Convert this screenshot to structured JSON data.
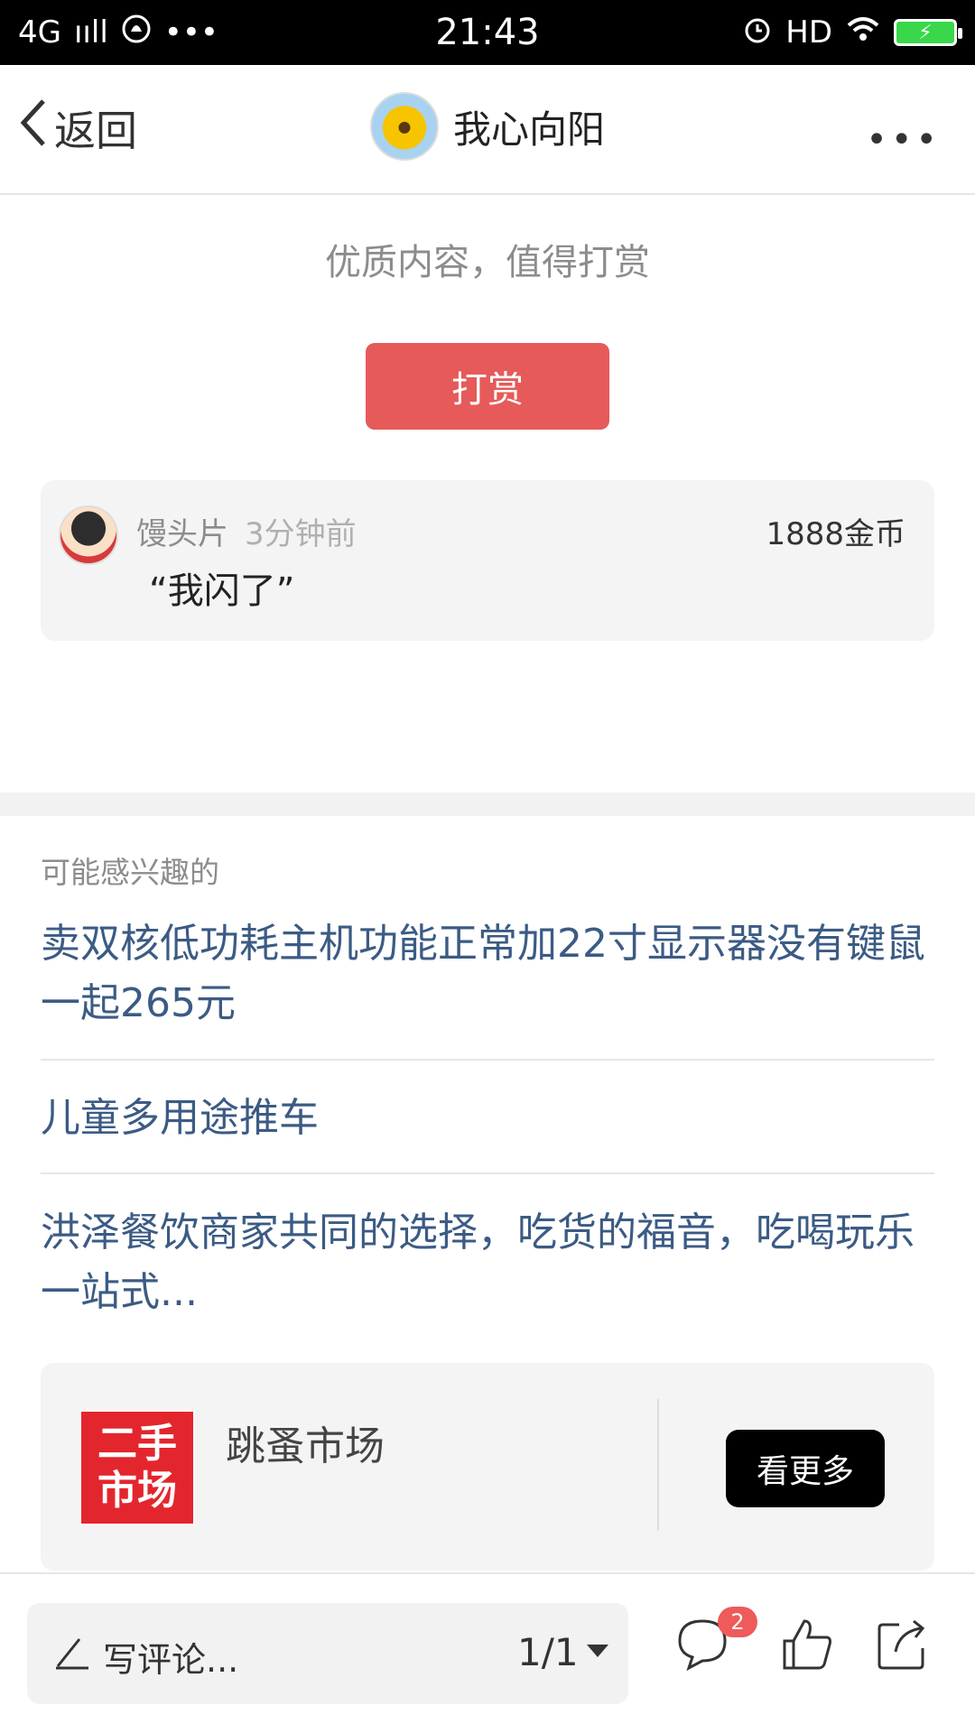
{
  "status_bar": {
    "network": "4G",
    "signal": "ııll",
    "dots": "•••",
    "time": "21:43",
    "hd": "HD"
  },
  "nav": {
    "back_label": "返回",
    "title": "我心向阳",
    "more_label": "•••"
  },
  "reward": {
    "hint": "优质内容，值得打赏",
    "button_label": "打赏",
    "record": {
      "user": "馒头片",
      "time": "3分钟前",
      "amount": "1888金币",
      "message": "“我闪了”"
    }
  },
  "interests": {
    "title": "可能感兴趣的",
    "items": [
      {
        "text": "卖双核低功耗主机功能正常加22寸显示器没有键鼠一起265元"
      },
      {
        "text": "儿童多用途推车"
      },
      {
        "text": "洪泽餐饮商家共同的选择，吃货的福音，吃喝玩乐一站式..."
      }
    ]
  },
  "market": {
    "logo_line1": "二手",
    "logo_line2": "市场",
    "name": "跳蚤市场",
    "button_label": "看更多"
  },
  "bottom_bar": {
    "comment_placeholder": "写评论...",
    "page_indicator": "1/1",
    "comment_badge": "2"
  },
  "colors": {
    "accent_red": "#e65a5a",
    "link_blue": "#3b5b84",
    "market_red": "#e3262d"
  }
}
